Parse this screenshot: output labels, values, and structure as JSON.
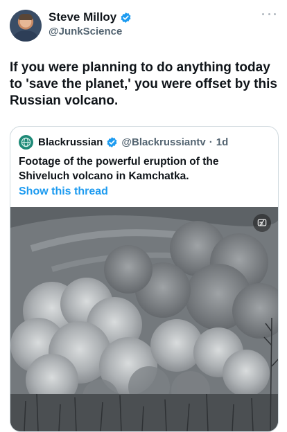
{
  "tweet": {
    "author_name": "Steve Milloy",
    "author_handle": "@JunkScience",
    "text": "If you were planning to do anything today to 'save the planet,' you were offset by this Russian volcano."
  },
  "quoted": {
    "author_name": "Blackrussian",
    "author_handle": "@Blackrussiantv",
    "separator": "·",
    "time": "1d",
    "text": "Footage of the powerful eruption of the Shiveluch volcano in Kamchatka.",
    "show_thread_label": "Show this thread"
  },
  "colors": {
    "accent": "#1d9bf0",
    "secondary_text": "#536471",
    "border": "#cfd9de"
  },
  "icons": [
    "verified-icon",
    "more-icon",
    "video-caption-icon"
  ]
}
